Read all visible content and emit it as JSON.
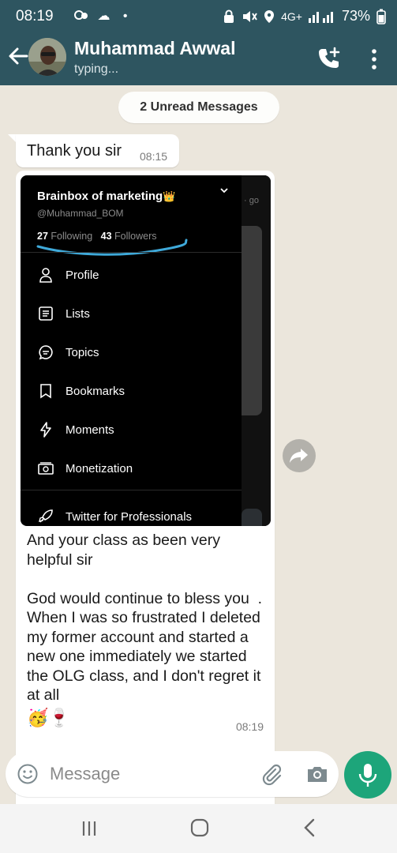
{
  "status_bar": {
    "time": "08:19",
    "left_icons": "☁ •",
    "network": "4G+",
    "battery": "73%"
  },
  "header": {
    "contact_name": "Muhammad Awwal",
    "status": "typing..."
  },
  "chat": {
    "unread_label": "2 Unread Messages",
    "message1": {
      "text": "Thank you sir",
      "time": "08:15"
    },
    "message2": {
      "text": "And your class as been very helpful sir\n\nGod would continue to bless you  .  When I was so frustrated I deleted my former account and started a new one immediately we started the OLG class, and I don't regret it at all",
      "emoji": "🥳🍷",
      "time": "08:19"
    }
  },
  "screenshot": {
    "account_name": "Brainbox of marketing",
    "crown": "👑",
    "handle": "@Muhammad_BOM",
    "following_count": "27",
    "following_label": "Following",
    "followers_count": "43",
    "followers_label": "Followers",
    "go_label": "· go",
    "menu": [
      {
        "label": "Profile",
        "icon": "person-icon"
      },
      {
        "label": "Lists",
        "icon": "list-icon"
      },
      {
        "label": "Topics",
        "icon": "topics-icon"
      },
      {
        "label": "Bookmarks",
        "icon": "bookmark-icon"
      },
      {
        "label": "Moments",
        "icon": "lightning-icon"
      },
      {
        "label": "Monetization",
        "icon": "money-icon"
      },
      {
        "label": "Twitter for Professionals",
        "icon": "rocket-icon"
      }
    ]
  },
  "composer": {
    "placeholder": "Message"
  },
  "colors": {
    "header": "#2e5560",
    "chat_bg": "#ebe6dc",
    "bubble": "#ffffff",
    "mic_button": "#1da57a",
    "scribble": "#3fa9d9"
  }
}
